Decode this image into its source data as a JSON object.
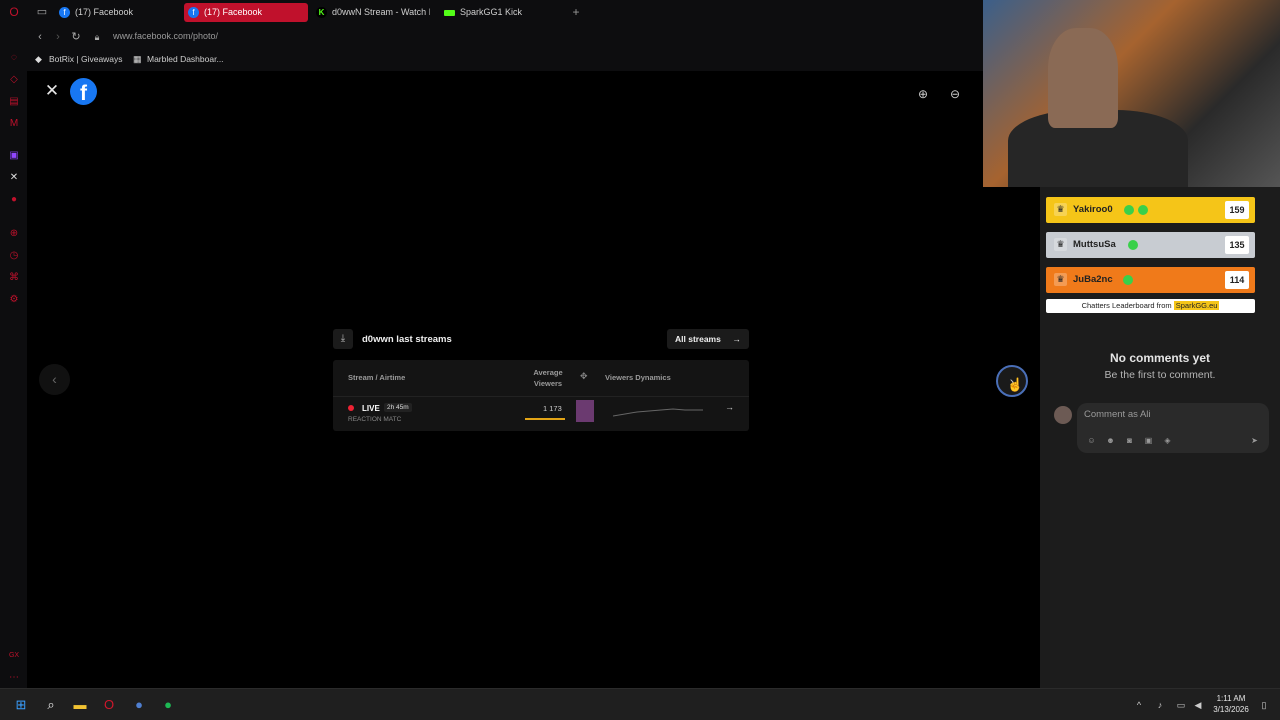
{
  "browser": {
    "tabs": [
      {
        "label": "(17) Facebook",
        "icon": "facebook-icon",
        "active": false
      },
      {
        "label": "(17) Facebook",
        "icon": "facebook-icon",
        "active": true
      },
      {
        "label": "d0wwN Stream - Watch L",
        "icon": "kick-icon",
        "active": false
      },
      {
        "label": "SparkGG1 Kick",
        "icon": "spark-icon",
        "active": false
      }
    ],
    "url": "www.facebook.com/photo/",
    "bookmarks": [
      {
        "label": "BotRix | Giveaways",
        "icon": "botrix-icon"
      },
      {
        "label": "Marbled Dashboar...",
        "icon": "dashboard-icon"
      }
    ],
    "accent_color": "#c0112c"
  },
  "streams_card": {
    "title": "d0wwn last streams",
    "all_streams_label": "All streams",
    "columns": {
      "stream": "Stream / Airtime",
      "avg_viewers": "Average Viewers",
      "dynamics": "Viewers Dynamics"
    },
    "row": {
      "status": "LIVE",
      "duration": "2h 45m",
      "subtitle": "REACTION MATC",
      "avg_viewers": "1 173"
    }
  },
  "leaderboard": {
    "rows": [
      {
        "name": "Yakiroo0",
        "score": "159",
        "color": "#f5c518"
      },
      {
        "name": "MuttsuSa",
        "score": "135",
        "color": "#c8ccd2"
      },
      {
        "name": "JuBa2nc",
        "score": "114",
        "color": "#f07a1a"
      }
    ],
    "footer_prefix": "Chatters Leaderboard from",
    "footer_brand": "SparkGG.eu"
  },
  "comments": {
    "empty_title": "No comments yet",
    "empty_subtitle": "Be the first to comment.",
    "input_placeholder": "Comment as Ali"
  },
  "taskbar": {
    "time": "1:11 AM",
    "date": "3/13/2026"
  }
}
